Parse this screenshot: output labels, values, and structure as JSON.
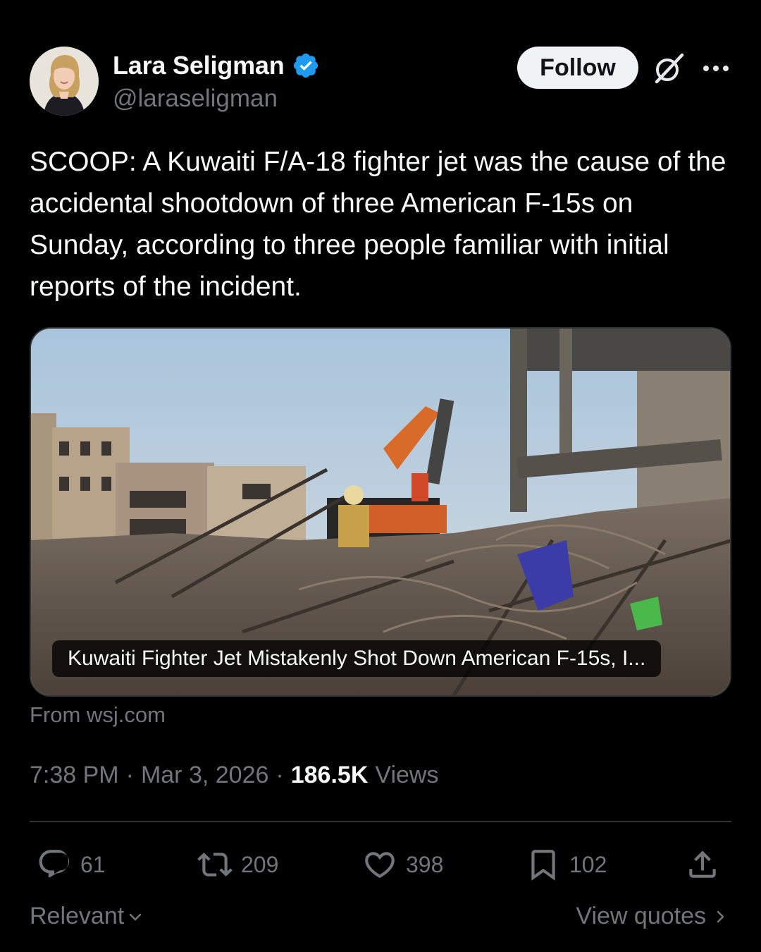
{
  "author": {
    "name": "Lara Seligman",
    "handle": "@laraseligman",
    "verified": true
  },
  "header": {
    "follow_label": "Follow"
  },
  "tweet": {
    "text": "SCOOP: A Kuwaiti F/A-18 fighter jet was the cause of the accidental shootdown of three American F-15s on Sunday, according to three people familiar with initial reports of the incident.",
    "media_caption": "Kuwaiti Fighter Jet Mistakenly Shot Down American F-15s, I...",
    "source": "From wsj.com",
    "time": "7:38 PM",
    "date": "Mar 3, 2026",
    "views_count": "186.5K",
    "views_label": "Views"
  },
  "actions": {
    "replies": "61",
    "reposts": "209",
    "likes": "398",
    "bookmarks": "102"
  },
  "footer": {
    "sort_label": "Relevant",
    "quotes_label": "View quotes"
  },
  "colors": {
    "background": "#000000",
    "text_primary": "#f7f9f9",
    "text_secondary": "#71767b",
    "verified_blue": "#1d9bf0",
    "divider": "#2f3336"
  }
}
